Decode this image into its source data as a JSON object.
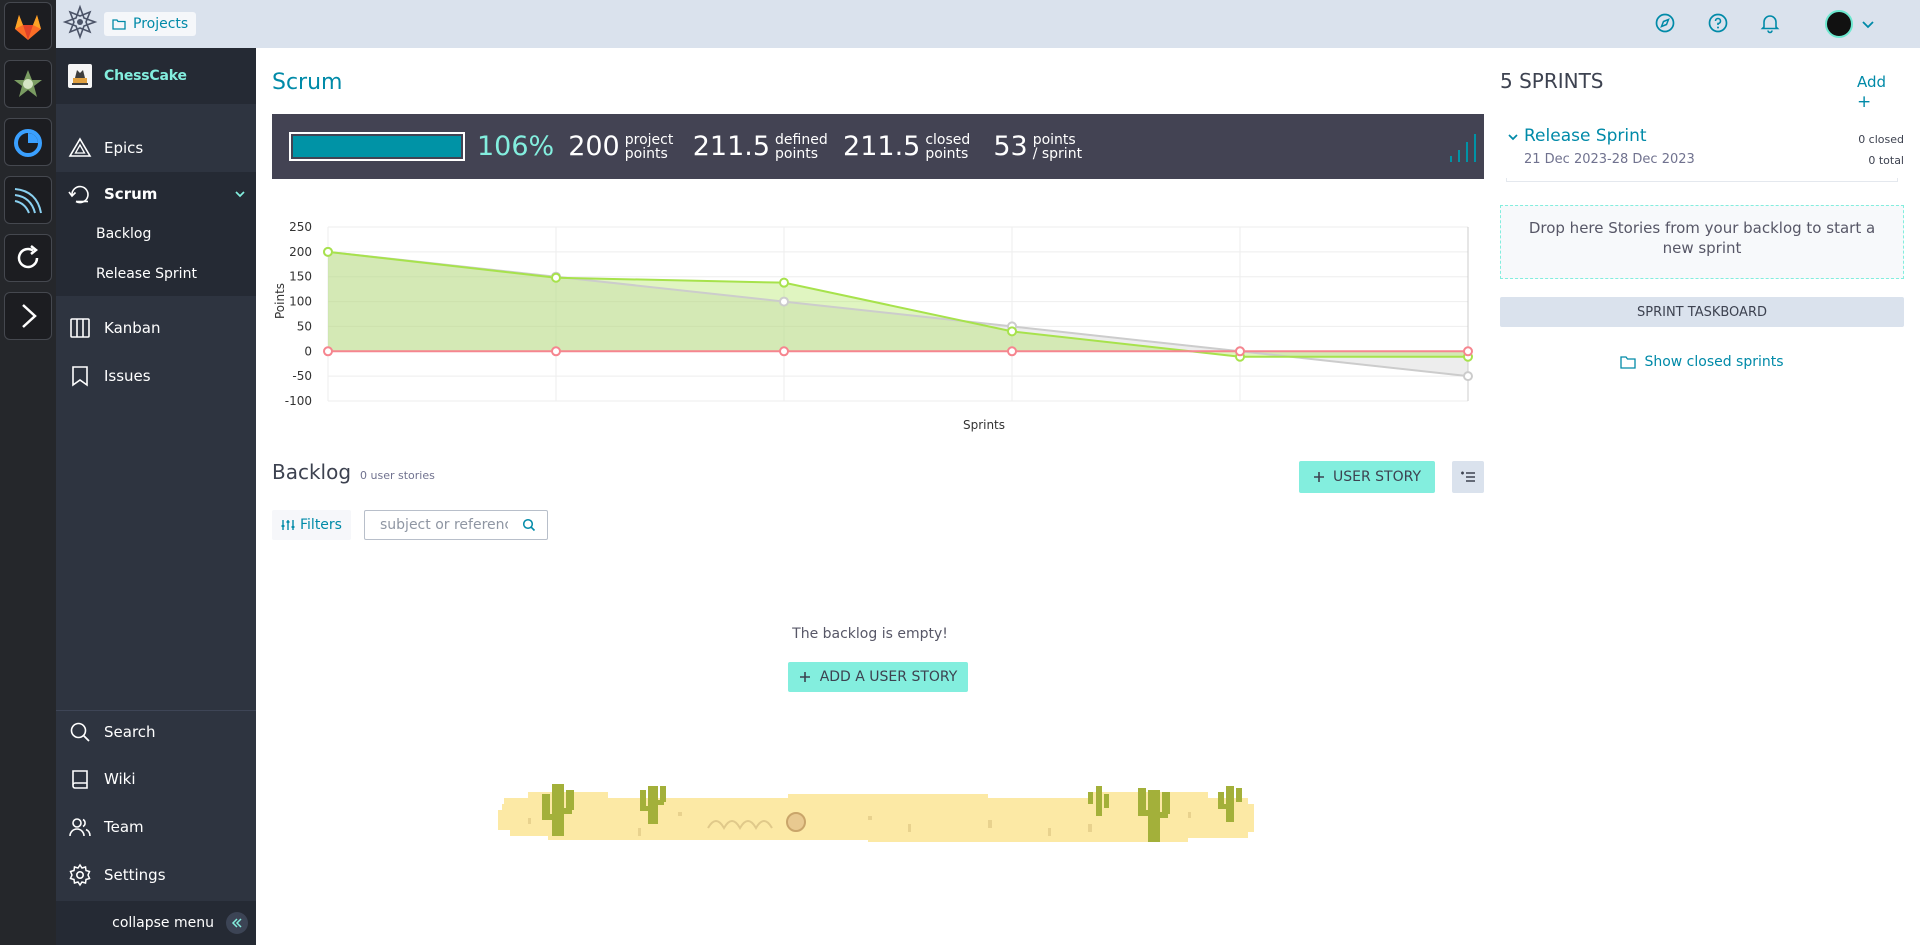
{
  "dock": {
    "apps": [
      "gitlab-app",
      "inkscape-app",
      "timer-app",
      "terminal-app",
      "refresh-app",
      "arrow-app"
    ]
  },
  "topbar": {
    "projects_label": "Projects"
  },
  "sidebar": {
    "project_name": "ChessCake",
    "items": [
      {
        "label": "Epics",
        "icon": "epics-icon"
      },
      {
        "label": "Scrum",
        "icon": "scrum-icon"
      },
      {
        "label": "Kanban",
        "icon": "kanban-icon"
      },
      {
        "label": "Issues",
        "icon": "issues-icon"
      },
      {
        "label": "Search",
        "icon": "search-icon"
      },
      {
        "label": "Wiki",
        "icon": "wiki-icon"
      },
      {
        "label": "Team",
        "icon": "team-icon"
      },
      {
        "label": "Settings",
        "icon": "settings-icon"
      }
    ],
    "scrum_sub": [
      "Backlog",
      "Release Sprint"
    ],
    "collapse_label": "collapse menu"
  },
  "main": {
    "title": "Scrum",
    "stats": {
      "progress_pct": 100,
      "percent": "106%",
      "project_points": "200",
      "project_points_label": "project points",
      "defined_points": "211.5",
      "defined_points_label": "defined points",
      "closed_points": "211.5",
      "closed_points_label": "closed points",
      "points_per_sprint": "53",
      "points_per_sprint_label": "points / sprint"
    },
    "backlog": {
      "title": "Backlog",
      "count": "0 user stories",
      "user_story_button": "USER STORY",
      "filters_label": "Filters",
      "search_placeholder": "subject or reference",
      "empty_message": "The backlog is empty!",
      "add_user_story_button": "ADD A USER STORY"
    }
  },
  "sprints_panel": {
    "title": "5 SPRINTS",
    "add_label": "Add",
    "sprint": {
      "name": "Release Sprint",
      "dates": "21 Dec 2023-28 Dec 2023",
      "closed": "0 closed",
      "total": "0 total"
    },
    "drop_text": "Drop here Stories from your backlog to start a new sprint",
    "taskboard_button": "SPRINT TASKBOARD",
    "show_closed": "Show closed sprints"
  },
  "chart_data": {
    "type": "area",
    "title": "",
    "xlabel": "Sprints",
    "ylabel": "Points",
    "ylim": [
      -100,
      250
    ],
    "yticks": [
      250,
      200,
      150,
      100,
      50,
      0,
      -50,
      -100
    ],
    "x": [
      0,
      1,
      2,
      3,
      4,
      5
    ],
    "series": [
      {
        "name": "",
        "color": "#cccccc",
        "values": [
          200,
          150,
          100,
          50,
          0,
          -50
        ]
      },
      {
        "name": "",
        "color": "#a7e24c",
        "values": [
          200,
          148,
          138,
          40,
          -11,
          -11
        ]
      },
      {
        "name": "",
        "color": "#f6858f",
        "values": [
          0,
          0,
          0,
          0,
          0,
          0
        ]
      }
    ],
    "grid": true
  }
}
